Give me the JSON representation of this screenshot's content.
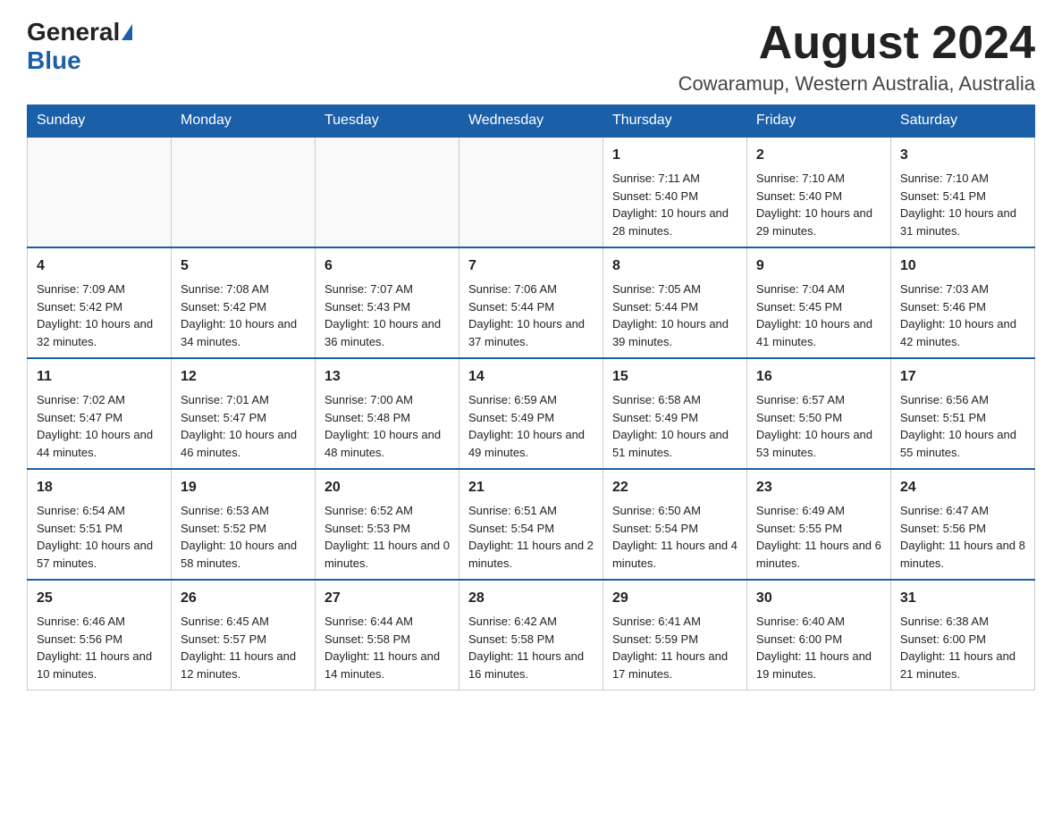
{
  "header": {
    "logo_general": "General",
    "logo_blue": "Blue",
    "month_title": "August 2024",
    "location": "Cowaramup, Western Australia, Australia"
  },
  "weekdays": [
    "Sunday",
    "Monday",
    "Tuesday",
    "Wednesday",
    "Thursday",
    "Friday",
    "Saturday"
  ],
  "weeks": [
    [
      {
        "day": "",
        "info": ""
      },
      {
        "day": "",
        "info": ""
      },
      {
        "day": "",
        "info": ""
      },
      {
        "day": "",
        "info": ""
      },
      {
        "day": "1",
        "info": "Sunrise: 7:11 AM\nSunset: 5:40 PM\nDaylight: 10 hours and 28 minutes."
      },
      {
        "day": "2",
        "info": "Sunrise: 7:10 AM\nSunset: 5:40 PM\nDaylight: 10 hours and 29 minutes."
      },
      {
        "day": "3",
        "info": "Sunrise: 7:10 AM\nSunset: 5:41 PM\nDaylight: 10 hours and 31 minutes."
      }
    ],
    [
      {
        "day": "4",
        "info": "Sunrise: 7:09 AM\nSunset: 5:42 PM\nDaylight: 10 hours and 32 minutes."
      },
      {
        "day": "5",
        "info": "Sunrise: 7:08 AM\nSunset: 5:42 PM\nDaylight: 10 hours and 34 minutes."
      },
      {
        "day": "6",
        "info": "Sunrise: 7:07 AM\nSunset: 5:43 PM\nDaylight: 10 hours and 36 minutes."
      },
      {
        "day": "7",
        "info": "Sunrise: 7:06 AM\nSunset: 5:44 PM\nDaylight: 10 hours and 37 minutes."
      },
      {
        "day": "8",
        "info": "Sunrise: 7:05 AM\nSunset: 5:44 PM\nDaylight: 10 hours and 39 minutes."
      },
      {
        "day": "9",
        "info": "Sunrise: 7:04 AM\nSunset: 5:45 PM\nDaylight: 10 hours and 41 minutes."
      },
      {
        "day": "10",
        "info": "Sunrise: 7:03 AM\nSunset: 5:46 PM\nDaylight: 10 hours and 42 minutes."
      }
    ],
    [
      {
        "day": "11",
        "info": "Sunrise: 7:02 AM\nSunset: 5:47 PM\nDaylight: 10 hours and 44 minutes."
      },
      {
        "day": "12",
        "info": "Sunrise: 7:01 AM\nSunset: 5:47 PM\nDaylight: 10 hours and 46 minutes."
      },
      {
        "day": "13",
        "info": "Sunrise: 7:00 AM\nSunset: 5:48 PM\nDaylight: 10 hours and 48 minutes."
      },
      {
        "day": "14",
        "info": "Sunrise: 6:59 AM\nSunset: 5:49 PM\nDaylight: 10 hours and 49 minutes."
      },
      {
        "day": "15",
        "info": "Sunrise: 6:58 AM\nSunset: 5:49 PM\nDaylight: 10 hours and 51 minutes."
      },
      {
        "day": "16",
        "info": "Sunrise: 6:57 AM\nSunset: 5:50 PM\nDaylight: 10 hours and 53 minutes."
      },
      {
        "day": "17",
        "info": "Sunrise: 6:56 AM\nSunset: 5:51 PM\nDaylight: 10 hours and 55 minutes."
      }
    ],
    [
      {
        "day": "18",
        "info": "Sunrise: 6:54 AM\nSunset: 5:51 PM\nDaylight: 10 hours and 57 minutes."
      },
      {
        "day": "19",
        "info": "Sunrise: 6:53 AM\nSunset: 5:52 PM\nDaylight: 10 hours and 58 minutes."
      },
      {
        "day": "20",
        "info": "Sunrise: 6:52 AM\nSunset: 5:53 PM\nDaylight: 11 hours and 0 minutes."
      },
      {
        "day": "21",
        "info": "Sunrise: 6:51 AM\nSunset: 5:54 PM\nDaylight: 11 hours and 2 minutes."
      },
      {
        "day": "22",
        "info": "Sunrise: 6:50 AM\nSunset: 5:54 PM\nDaylight: 11 hours and 4 minutes."
      },
      {
        "day": "23",
        "info": "Sunrise: 6:49 AM\nSunset: 5:55 PM\nDaylight: 11 hours and 6 minutes."
      },
      {
        "day": "24",
        "info": "Sunrise: 6:47 AM\nSunset: 5:56 PM\nDaylight: 11 hours and 8 minutes."
      }
    ],
    [
      {
        "day": "25",
        "info": "Sunrise: 6:46 AM\nSunset: 5:56 PM\nDaylight: 11 hours and 10 minutes."
      },
      {
        "day": "26",
        "info": "Sunrise: 6:45 AM\nSunset: 5:57 PM\nDaylight: 11 hours and 12 minutes."
      },
      {
        "day": "27",
        "info": "Sunrise: 6:44 AM\nSunset: 5:58 PM\nDaylight: 11 hours and 14 minutes."
      },
      {
        "day": "28",
        "info": "Sunrise: 6:42 AM\nSunset: 5:58 PM\nDaylight: 11 hours and 16 minutes."
      },
      {
        "day": "29",
        "info": "Sunrise: 6:41 AM\nSunset: 5:59 PM\nDaylight: 11 hours and 17 minutes."
      },
      {
        "day": "30",
        "info": "Sunrise: 6:40 AM\nSunset: 6:00 PM\nDaylight: 11 hours and 19 minutes."
      },
      {
        "day": "31",
        "info": "Sunrise: 6:38 AM\nSunset: 6:00 PM\nDaylight: 11 hours and 21 minutes."
      }
    ]
  ]
}
